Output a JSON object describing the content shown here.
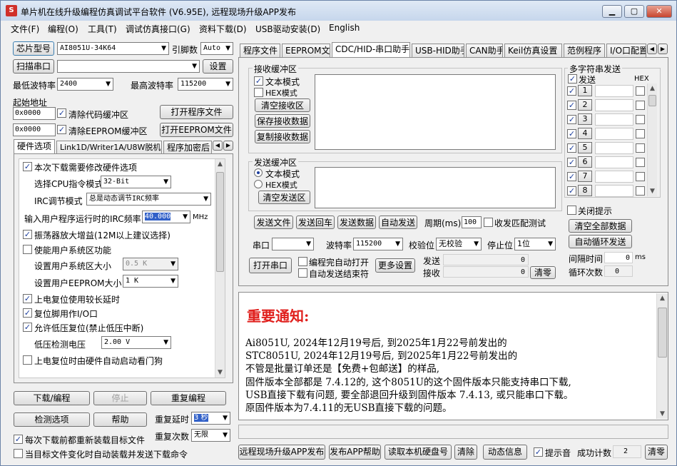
{
  "window": {
    "title": "单片机在线升级编程仿真调试平台软件 (V6.95E), 远程现场升级APP发布",
    "app_icon": "S",
    "controls": [
      "minimize-icon",
      "maximize-icon",
      "close-icon"
    ]
  },
  "menu": [
    "文件(F)",
    "编程(O)",
    "工具(T)",
    "调试仿真接口(G)",
    "资料下载(D)",
    "USB驱动安装(D)",
    "English"
  ],
  "left": {
    "chip_button": "芯片型号",
    "chip_value": "AI8051U-34K64",
    "pins_label": "引脚数",
    "pins_value": "Auto",
    "scan_button": "扫描串口",
    "port_value": "",
    "settings_button": "设置",
    "min_baud_label": "最低波特率",
    "min_baud_value": "2400",
    "max_baud_label": "最高波特率",
    "max_baud_value": "115200",
    "start_addr_label": "起始地址",
    "addr1": "0x0000",
    "clear_code_label": "清除代码缓冲区",
    "open_prog_button": "打开程序文件",
    "addr2": "0x0000",
    "clear_eeprom_label": "清除EEPROM缓冲区",
    "open_eeprom_button": "打开EEPROM文件",
    "tabs": [
      "硬件选项",
      "Link1D/Writer1A/U8W脱机",
      "程序加密后"
    ],
    "hw": {
      "modify_hw_label": "本次下载需要修改硬件选项",
      "cpu_mode_label": "选择CPU指令模式",
      "cpu_mode_value": "32-Bit",
      "irc_mode_label": "IRC调节模式",
      "irc_mode_value": "总是动态调节IRC频率",
      "irc_freq_label": "输入用户程序运行时的IRC频率",
      "irc_freq_value": "40.000",
      "irc_freq_unit": "MHz",
      "osc_label": "振荡器放大增益(12M以上建议选择)",
      "sys_area_label": "使能用户系统区功能",
      "sys_size_label": "设置用户系统区大小",
      "sys_size_value": "0.5 K",
      "eeprom_size_label": "设置用户EEPROM大小",
      "eeprom_size_value": "1  K",
      "long_delay_label": "上电复位使用较长延时",
      "reset_io_label": "复位脚用作I/O口",
      "lvr_label": "允许低压复位(禁止低压中断)",
      "lvd_label": "低压检测电压",
      "lvd_value": "2.00 V",
      "wdt_label": "上电复位时由硬件自动启动看门狗"
    },
    "download_button": "下载/编程",
    "stop_button": "停止",
    "reprogram_button": "重复编程",
    "detect_button": "检测选项",
    "help_button": "帮助",
    "repeat_delay_label": "重复延时",
    "repeat_delay_value": "3 秒",
    "repeat_count_label": "重复次数",
    "repeat_count_value": "无限",
    "reload_label": "每次下载前都重新装载目标文件",
    "auto_send_label": "当目标文件变化时自动装载并发送下载命令"
  },
  "right": {
    "tabs": [
      "程序文件",
      "EEPROM文件",
      "CDC/HID-串口助手",
      "USB-HID助手",
      "CAN助手",
      "Keil仿真设置",
      "范例程序",
      "I/O口配置"
    ],
    "recv": {
      "group_label": "接收缓冲区",
      "text_mode": "文本模式",
      "hex_mode": "HEX模式",
      "clear_button": "清空接收区",
      "save_button": "保存接收数据",
      "copy_button": "复制接收数据"
    },
    "send": {
      "group_label": "发送缓冲区",
      "text_mode": "文本模式",
      "hex_mode": "HEX模式",
      "clear_button": "清空发送区",
      "send_file": "发送文件",
      "send_enter": "发送回车",
      "send_data": "发送数据",
      "auto_send": "自动发送",
      "period_label": "周期(ms)",
      "period_value": "100",
      "match_label": "收发匹配测试"
    },
    "serial": {
      "port_label": "串口",
      "port_value": "",
      "baud_label": "波特率",
      "baud_value": "115200",
      "parity_label": "校验位",
      "parity_value": "无校验",
      "stop_label": "停止位",
      "stop_value": "1位",
      "open_button": "打开串口",
      "auto_open_label": "编程完自动打开",
      "auto_close_label": "自动发送结束符",
      "more_button": "更多设置",
      "send_label": "发送",
      "send_count": "0",
      "recv_label": "接收",
      "recv_count": "0",
      "clear_button": "清零"
    },
    "multi": {
      "group_label": "多字符串发送",
      "send_header": "发送",
      "hex_header": "HEX",
      "rows": [
        "1",
        "2",
        "3",
        "4",
        "5",
        "6",
        "7",
        "8"
      ],
      "close_tip_label": "关闭提示",
      "clear_all_button": "清空全部数据",
      "auto_loop_button": "自动循环发送",
      "interval_label": "间隔时间",
      "interval_value": "0",
      "interval_unit": "ms",
      "loop_count_label": "循环次数",
      "loop_count_value": "0"
    },
    "notice": {
      "title": "重要通知:",
      "lines": [
        "Ai8051U,  2024年12月19号后, 到2025年1月22号前发出的",
        "STC8051U, 2024年12月19号后, 到2025年1月22号前发出的",
        "不管是批量订单还是【免费+包邮送】的样品,",
        "固件版本全部都是 7.4.12的, 这个8051U的这个固件版本只能支持串口下载,",
        "USB直接下载有问题, 要全部退回升级到固件版本 7.4.13, 或只能串口下载。",
        "原固件版本为7.4.11的无USB直接下载的问题。"
      ]
    },
    "status_text": "",
    "bottom": {
      "publish_button": "远程现场升级APP发布",
      "help_button": "发布APP帮助",
      "read_id_button": "读取本机硬盘号",
      "clear_button": "清除",
      "dyn_info_button": "动态信息",
      "beep_label": "提示音",
      "success_label": "成功计数",
      "success_value": "2",
      "reset_button": "清零"
    }
  }
}
